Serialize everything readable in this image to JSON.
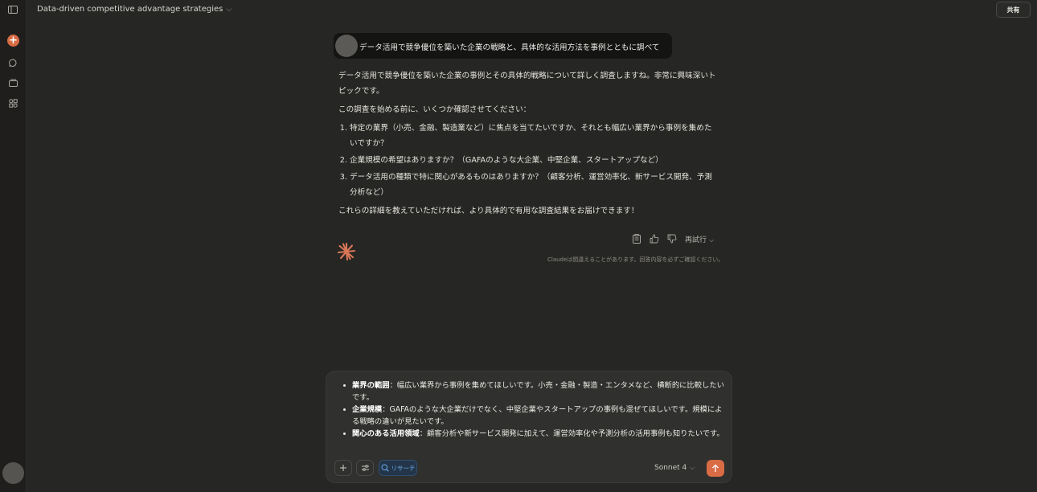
{
  "window": {
    "title": "Data-driven competitive advantage strategies",
    "share_label": "共有"
  },
  "sidebar": {
    "icons": [
      "sidebar-toggle-icon",
      "new-chat-icon",
      "chats-icon",
      "projects-icon",
      "artifacts-icon"
    ]
  },
  "conversation": {
    "user_message": "データ活用で競争優位を築いた企業の戦略と、具体的な活用方法を事例とともに調べて",
    "response": {
      "intro": "データ活用で競争優位を築いた企業の事例とその具体的戦略について詳しく調査しますね。非常に興味深いトピックです。",
      "lead": "この調査を始める前に、いくつか確認させてください：",
      "questions": [
        "特定の業界（小売、金融、製造業など）に焦点を当てたいですか、それとも幅広い業界から事例を集めたいですか？",
        "企業規模の希望はありますか？（GAFAのような大企業、中堅企業、スタートアップなど）",
        "データ活用の種類で特に関心があるものはありますか？（顧客分析、運営効率化、新サービス開発、予測分析など）"
      ],
      "closing": "これらの詳細を教えていただければ、より具体的で有用な調査結果をお届けできます！"
    },
    "retry_label": "再試行",
    "disclaimer": "Claudeは間違えることがあります。回答内容を必ずご確認ください。"
  },
  "composer": {
    "bullets": [
      {
        "bold": "業界の範囲",
        "text": "：幅広い業界から事例を集めてほしいです。小売・金融・製造・エンタメなど、横断的に比較したいです。"
      },
      {
        "bold": "企業規模",
        "text": "：GAFAのような大企業だけでなく、中堅企業やスタートアップの事例も混ぜてほしいです。規模による戦略の違いが見たいです。"
      },
      {
        "bold": "関心のある活用領域",
        "text": "：顧客分析や新サービス開発に加えて、運営効率化や予測分析の活用事例も知りたいです。"
      }
    ],
    "research_label": "リサーチ",
    "model": "Sonnet 4",
    "accent_color": "#d96b45"
  }
}
